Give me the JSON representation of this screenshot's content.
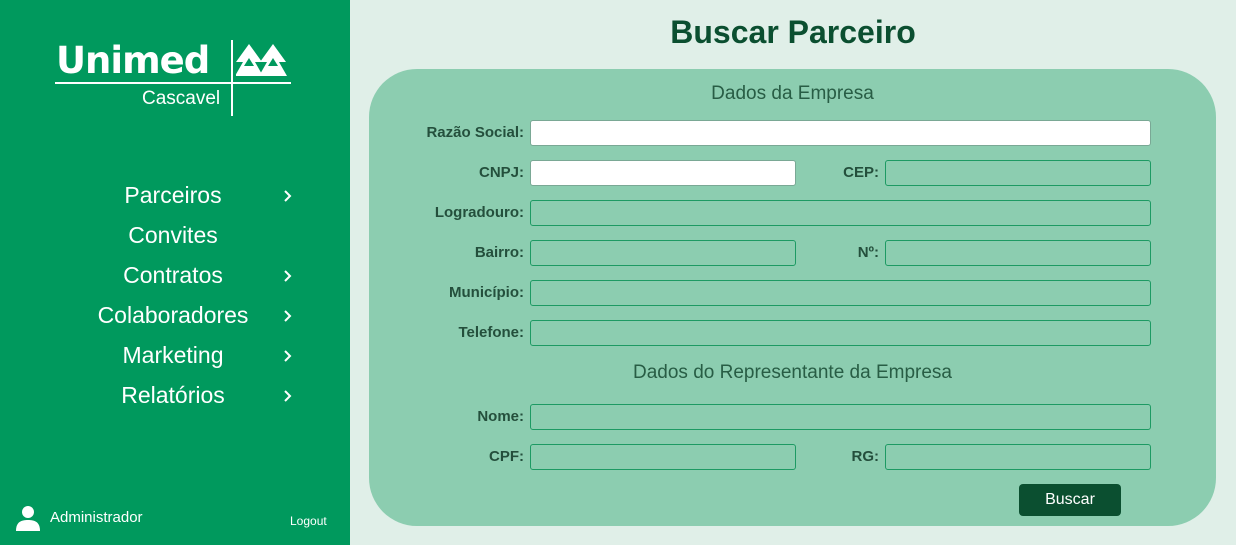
{
  "brand": {
    "name": "Unimed",
    "location": "Cascavel"
  },
  "nav": {
    "items": [
      {
        "label": "Parceiros",
        "has_submenu": true
      },
      {
        "label": "Convites",
        "has_submenu": false
      },
      {
        "label": "Contratos",
        "has_submenu": true
      },
      {
        "label": "Colaboradores",
        "has_submenu": true
      },
      {
        "label": "Marketing",
        "has_submenu": true
      },
      {
        "label": "Relatórios",
        "has_submenu": true
      }
    ]
  },
  "user": {
    "name": "Administrador",
    "logout_label": "Logout",
    "icon": "user-icon"
  },
  "page": {
    "title": "Buscar Parceiro"
  },
  "company": {
    "section_title": "Dados da Empresa",
    "razao_social_label": "Razão Social:",
    "cnpj_label": "CNPJ:",
    "cep_label": "CEP:",
    "logradouro_label": "Logradouro:",
    "bairro_label": "Bairro:",
    "numero_label": "Nº:",
    "municipio_label": "Município:",
    "telefone_label": "Telefone:"
  },
  "representative": {
    "section_title": "Dados do Representante da Empresa",
    "nome_label": "Nome:",
    "cpf_label": "CPF:",
    "rg_label": "RG:"
  },
  "actions": {
    "search_label": "Buscar"
  },
  "colors": {
    "sidebar": "#00995d",
    "background": "#e0efe8",
    "card": "#8ccdb0",
    "accent_dark": "#0b4f30"
  }
}
